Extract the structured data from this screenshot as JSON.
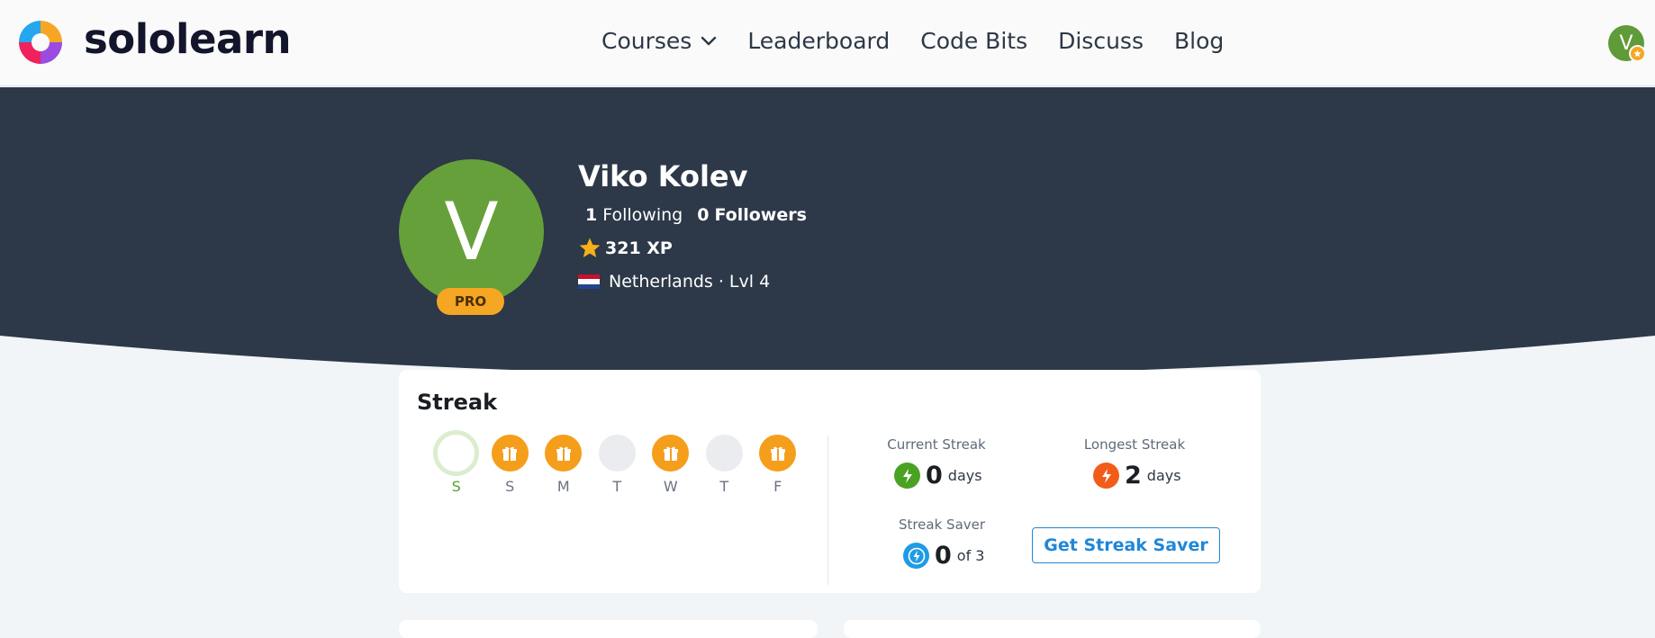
{
  "brand": {
    "name": "sololearn"
  },
  "nav": {
    "items": [
      {
        "label": "Courses",
        "has_dropdown": true
      },
      {
        "label": "Leaderboard"
      },
      {
        "label": "Code Bits"
      },
      {
        "label": "Discuss"
      },
      {
        "label": "Blog"
      }
    ]
  },
  "header_avatar": {
    "initial": "V"
  },
  "profile": {
    "initial": "V",
    "badge": "PRO",
    "name": "Viko Kolev",
    "following_count": "1",
    "following_label": "Following",
    "followers_count": "0",
    "followers_label": "Followers",
    "xp": "321 XP",
    "location": "Netherlands · Lvl 4"
  },
  "streak": {
    "title": "Streak",
    "days": [
      {
        "label": "S",
        "state": "today"
      },
      {
        "label": "S",
        "state": "gift"
      },
      {
        "label": "M",
        "state": "gift"
      },
      {
        "label": "T",
        "state": "empty"
      },
      {
        "label": "W",
        "state": "gift"
      },
      {
        "label": "T",
        "state": "empty"
      },
      {
        "label": "F",
        "state": "gift"
      }
    ],
    "current_label": "Current Streak",
    "current_value": "0",
    "current_unit": "days",
    "longest_label": "Longest Streak",
    "longest_value": "2",
    "longest_unit": "days",
    "saver_label": "Streak Saver",
    "saver_value": "0",
    "saver_unit": "of 3",
    "saver_button": "Get Streak Saver"
  },
  "colors": {
    "hero": "#2d3848",
    "avatar": "#66a03a",
    "pro": "#f5a623",
    "gift": "#f59e1b",
    "current_icon": "#4aa224",
    "longest_icon": "#f25c19",
    "saver_icon": "#1f9be6",
    "link": "#1f87d8"
  }
}
